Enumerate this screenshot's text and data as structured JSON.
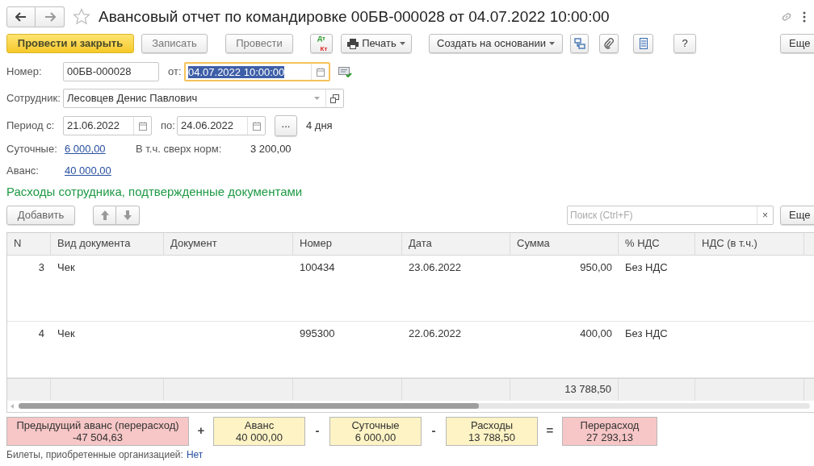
{
  "window": {
    "title": "Авансовый отчет по командировке 00БВ-000028 от 04.07.2022 10:00:00",
    "favorite": false
  },
  "toolbar": {
    "buttons": [
      {
        "label": "Провести и закрыть",
        "kind": "primary"
      },
      {
        "label": "Записать",
        "kind": "plain"
      },
      {
        "label": "Провести",
        "kind": "plain"
      },
      {
        "label": "Дт",
        "sublabel": "Кт",
        "kind": "dtkt"
      },
      {
        "label": "Печать",
        "kind": "print"
      },
      {
        "label": "Создать на основании",
        "kind": "menu"
      },
      {
        "kind": "structure"
      },
      {
        "kind": "attach"
      },
      {
        "kind": "report"
      },
      {
        "label": "?",
        "kind": "plain"
      },
      {
        "label": "Еще",
        "kind": "more"
      }
    ]
  },
  "form": {
    "number_label": "Номер:",
    "number": "00БВ-000028",
    "date_label": "от:",
    "date": "04.07.2022 10:00:00",
    "employee_label": "Сотрудник:",
    "employee": "Лесовцев Денис Павлович",
    "period_label": "Период с:",
    "period_from": "21.06.2022",
    "period_to_label": "по:",
    "period_to": "24.06.2022",
    "period_button": "...",
    "days": "4 дня",
    "per_diem_label": "Суточные:",
    "per_diem": "6 000,00",
    "over_norm_label": "В т.ч. сверх норм:",
    "over_norm": "3 200,00",
    "advance_label": "Аванс:",
    "advance": "40 000,00"
  },
  "section": {
    "title": "Расходы сотрудника, подтвержденные документами",
    "add_button": "Добавить",
    "search": {
      "placeholder": "Поиск (Ctrl+F)",
      "clear": "×"
    },
    "more_button": "Еще"
  },
  "table": {
    "columns": [
      "N",
      "Вид документа",
      "Документ",
      "Номер",
      "Дата",
      "Сумма",
      "% НДС",
      "НДС (в т.ч.)"
    ],
    "rows": [
      [
        "3",
        "Чек",
        "",
        "100434",
        "23.06.2022",
        "950,00",
        "Без НДС",
        ""
      ],
      [
        "4",
        "Чек",
        "",
        "995300",
        "22.06.2022",
        "400,00",
        "Без НДС",
        ""
      ]
    ],
    "total_amount": "13 788,50"
  },
  "summary": [
    {
      "label": "Предыдущий аванс (перерасход)",
      "value": "-47 504,63",
      "color": "#f7c6c6",
      "operator": "+"
    },
    {
      "label": "Аванс",
      "value": "40 000,00",
      "color": "#fdf3c4",
      "operator": "-"
    },
    {
      "label": "Суточные",
      "value": "6 000,00",
      "color": "#fdf3c4",
      "operator": "-"
    },
    {
      "label": "Расходы",
      "value": "13 788,50",
      "color": "#fdf3c4",
      "operator": "="
    },
    {
      "label": "Перерасход",
      "value": "27 293,13",
      "color": "#f7c6c6"
    }
  ],
  "tickets": {
    "label": "Билеты, приобретенные организацией:",
    "value": "Нет"
  }
}
